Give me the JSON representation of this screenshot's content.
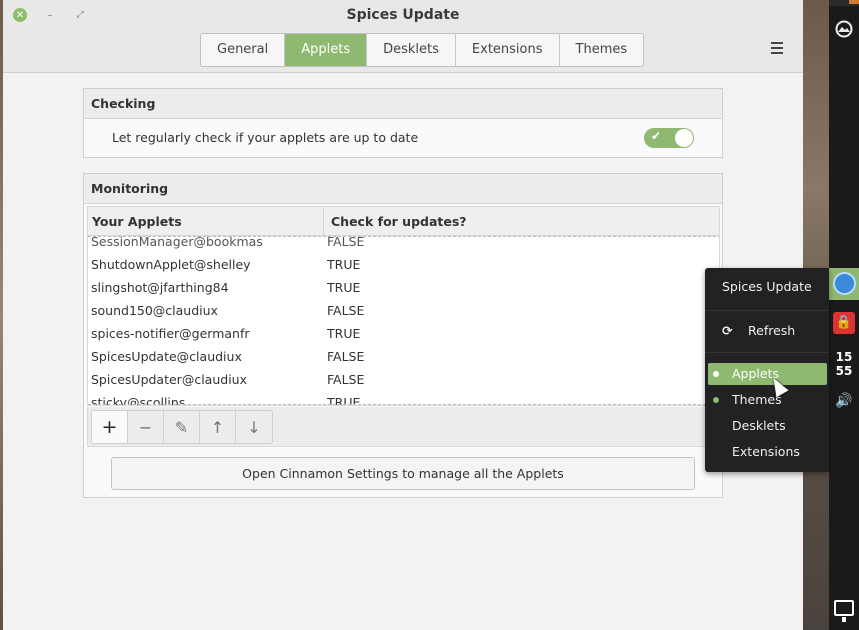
{
  "window": {
    "title": "Spices Update",
    "tabs": [
      {
        "label": "General",
        "active": false
      },
      {
        "label": "Applets",
        "active": true
      },
      {
        "label": "Desklets",
        "active": false
      },
      {
        "label": "Extensions",
        "active": false
      },
      {
        "label": "Themes",
        "active": false
      }
    ]
  },
  "checking": {
    "header": "Checking",
    "label": "Let regularly check if your applets are up to date",
    "toggle_on": true
  },
  "monitoring": {
    "header": "Monitoring",
    "columns": [
      "Your Applets",
      "Check for updates?"
    ],
    "partial_row": {
      "name": "SessionManager@bookmas",
      "value": "FALSE"
    },
    "rows": [
      {
        "name": "ShutdownApplet@shelley",
        "value": "TRUE"
      },
      {
        "name": "slingshot@jfarthing84",
        "value": "TRUE"
      },
      {
        "name": "sound150@claudiux",
        "value": "FALSE"
      },
      {
        "name": "spices-notifier@germanfr",
        "value": "TRUE"
      },
      {
        "name": "SpicesUpdate@claudiux",
        "value": "FALSE"
      },
      {
        "name": "SpicesUpdater@claudiux",
        "value": "FALSE"
      },
      {
        "name": "sticky@scollins",
        "value": "TRUE"
      }
    ],
    "toolbar_icons": [
      "add-icon",
      "remove-icon",
      "edit-icon",
      "move-up-icon",
      "move-down-icon"
    ],
    "settings_button": "Open Cinnamon Settings to manage all the Applets"
  },
  "menu": {
    "title": "Spices Update",
    "refresh": "Refresh",
    "items": [
      {
        "label": "Applets",
        "highlighted": true,
        "dot": true
      },
      {
        "label": "Themes",
        "highlighted": false,
        "dot": true
      },
      {
        "label": "Desklets",
        "highlighted": false,
        "dot": false
      },
      {
        "label": "Extensions",
        "highlighted": false,
        "dot": false
      }
    ]
  },
  "panel": {
    "clock_hour": "15",
    "clock_minute": "55"
  },
  "colors": {
    "accent": "#8fb870",
    "menu_bg": "#222222"
  }
}
